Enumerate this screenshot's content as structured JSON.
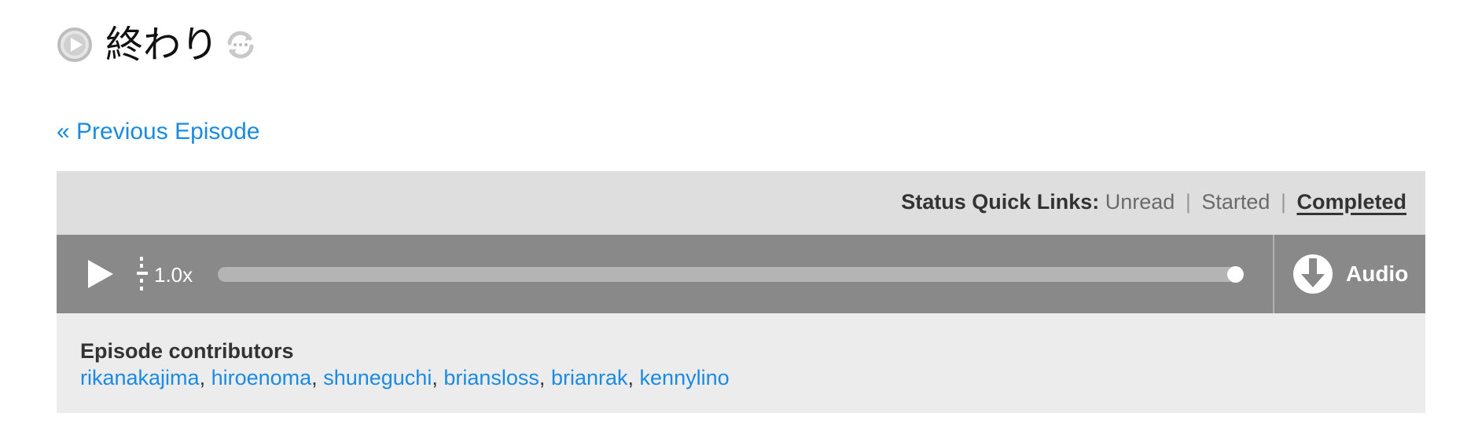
{
  "episode": {
    "title": "終わり",
    "prev_link": "« Previous Episode"
  },
  "status": {
    "label": "Status Quick Links:",
    "links": [
      "Unread",
      "Started",
      "Completed"
    ],
    "separator": "|",
    "current": "Completed"
  },
  "player": {
    "speed": "1.0x",
    "progress": 0.995,
    "download_label": "Audio"
  },
  "contributors": {
    "heading": "Episode contributors",
    "names": [
      "rikanakajima",
      "hiroenoma",
      "shuneguchi",
      "briansloss",
      "brianrak",
      "kennylino"
    ],
    "separator": ","
  },
  "colors": {
    "link": "#1a8be0",
    "player_bg": "#898989",
    "status_bar_bg": "#dedede",
    "panel_bg": "#ececec"
  },
  "icons": {
    "title_play": "play-circle-icon",
    "title_sync": "sync-icon",
    "player_play": "play-icon",
    "speed": "speed-icon",
    "download": "download-icon"
  }
}
